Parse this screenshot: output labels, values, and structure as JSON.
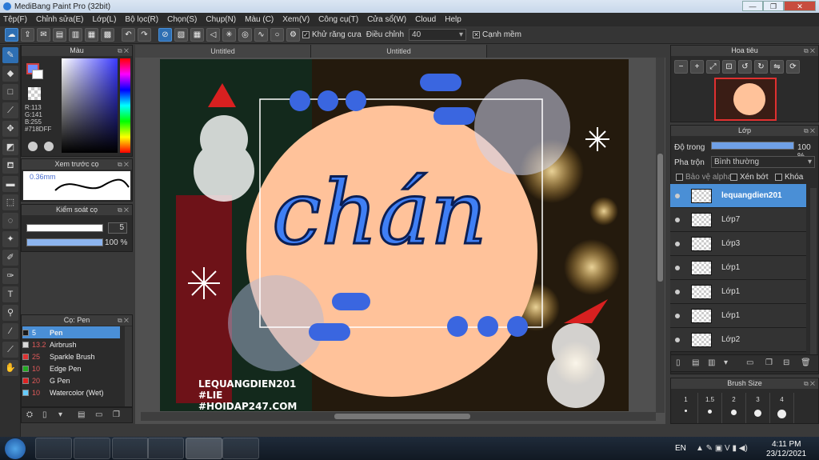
{
  "app": {
    "title": "MediBang Paint Pro (32bit)"
  },
  "menu": [
    "Tệp(F)",
    "Chỉnh sửa(E)",
    "Lớp(L)",
    "Bộ lọc(R)",
    "Chọn(S)",
    "Chụp(N)",
    "Màu (C)",
    "Xem(V)",
    "Công cụ(T)",
    "Cửa sổ(W)",
    "Cloud",
    "Help"
  ],
  "toolbar": {
    "antialias_label": "Khử răng cưa",
    "correction_label": "Điều chỉnh",
    "correction_value": "40",
    "snap_edges_label": "Cạnh mềm"
  },
  "color_panel": {
    "title": "Màu",
    "r": "R:113",
    "g": "G:141",
    "b": "B:255",
    "hex": "#718DFF",
    "current": "#718DFF"
  },
  "brush_preview": {
    "title": "Xem trước cọ",
    "size": "0.36mm"
  },
  "brush_control": {
    "title": "Kiểm soát cọ",
    "size_value": "5",
    "opacity_value": "100 %"
  },
  "brush_panel": {
    "title": "Cọ: Pen",
    "items": [
      {
        "size": "5",
        "name": "Pen",
        "color": "#1a1a1a"
      },
      {
        "size": "13.2",
        "name": "Airbrush",
        "color": "#d9d9d9"
      },
      {
        "size": "25",
        "name": "Sparkle Brush",
        "color": "#d33"
      },
      {
        "size": "10",
        "name": "Edge Pen",
        "color": "#2a2"
      },
      {
        "size": "20",
        "name": "G Pen",
        "color": "#d22"
      },
      {
        "size": "10",
        "name": "Watercolor (Wet)",
        "color": "#6cf"
      }
    ]
  },
  "tabs": [
    "Untitled",
    "Untitled"
  ],
  "artwork": {
    "title_text": "chán",
    "watermark": [
      "LEQUANGDIEN201",
      "#LIE",
      "#HOIDAP247.COM"
    ]
  },
  "navigator": {
    "title": "Hoa tiêu"
  },
  "layers": {
    "title": "Lớp",
    "opacity_label": "Độ trong",
    "opacity_value": "100 %",
    "opacity_fraction": 1.0,
    "blend_label": "Pha trộn",
    "blend_value": "Bình thường",
    "protect_alpha_label": "Bảo vệ alpha",
    "clip_label": "Xén bớt",
    "lock_label": "Khóa",
    "items": [
      {
        "name": "lequangdien201",
        "selected": true
      },
      {
        "name": "Lớp7",
        "selected": false
      },
      {
        "name": "Lớp3",
        "selected": false
      },
      {
        "name": "Lớp1",
        "selected": false
      },
      {
        "name": "Lớp1",
        "selected": false
      },
      {
        "name": "Lớp1",
        "selected": false
      },
      {
        "name": "Lớp2",
        "selected": false
      }
    ]
  },
  "brush_size": {
    "title": "Brush Size",
    "sizes": [
      "1",
      "1.5",
      "2",
      "3",
      "4"
    ]
  },
  "taskbar": {
    "lang": "EN",
    "time": "4:11 PM",
    "date": "23/12/2021"
  }
}
